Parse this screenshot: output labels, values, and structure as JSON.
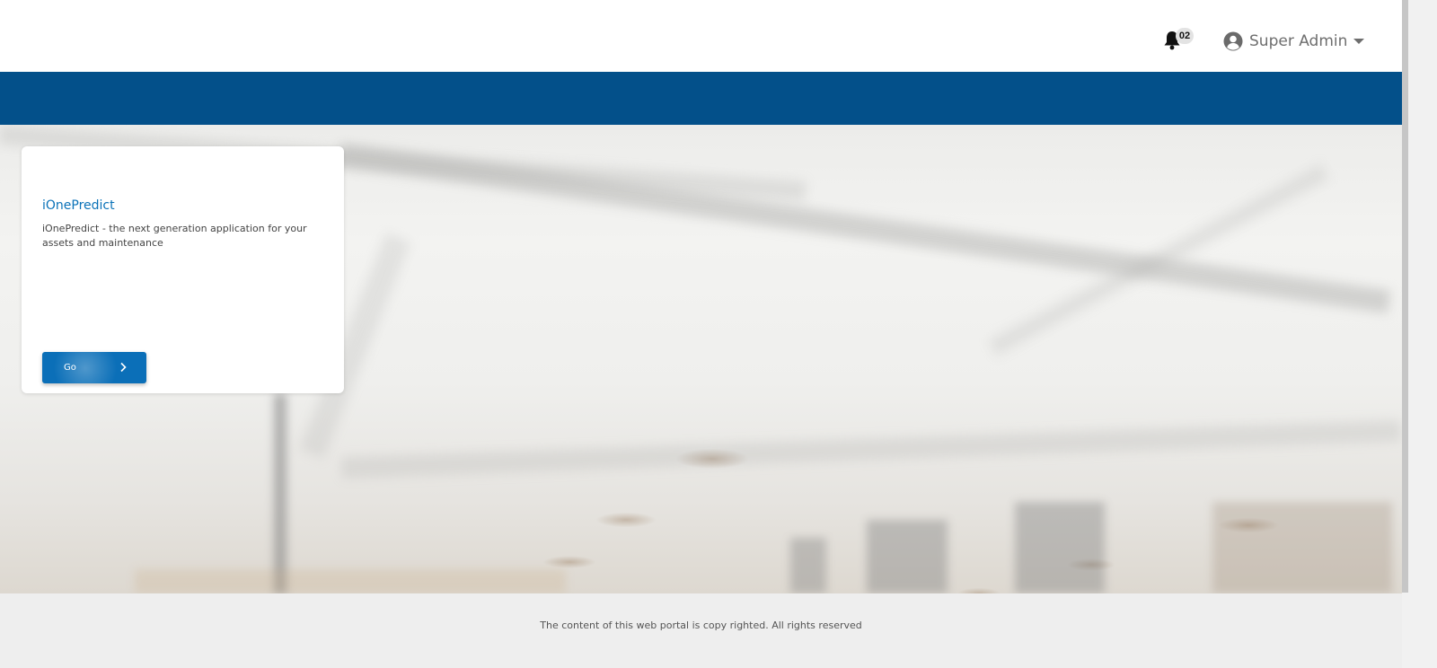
{
  "header": {
    "notifications": {
      "icon": "bell-icon",
      "count": "02"
    },
    "user": {
      "icon": "user-circle-icon",
      "name": "Super Admin",
      "menu_icon": "caret-down-icon"
    }
  },
  "colors": {
    "brand_bar": "#03508a",
    "accent": "#0b6fb8",
    "title": "#0a72b8",
    "footer_bg": "#eeeeee"
  },
  "card": {
    "title": "iOnePredict",
    "description": "iOnePredict - the next generation application for your assets and maintenance",
    "button_label": "Go",
    "button_icon": "chevron-right-icon"
  },
  "footer": {
    "text": "The content of this web portal is copy righted. All rights reserved"
  }
}
